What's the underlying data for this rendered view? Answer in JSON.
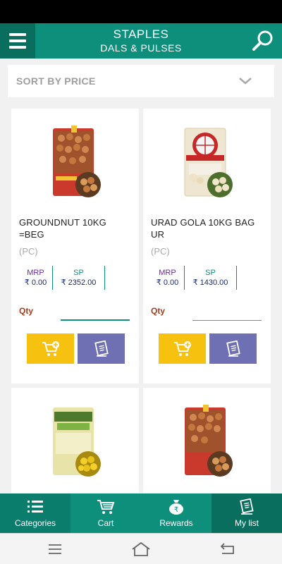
{
  "header": {
    "title": "STAPLES",
    "subtitle": "DALS & PULSES",
    "menu_icon": "hamburger-icon",
    "search_icon": "search-icon"
  },
  "sort": {
    "label": "SORT BY PRICE",
    "icon": "chevron-down-icon"
  },
  "products": [
    {
      "name": "GROUNDNUT 10KG =BEG",
      "unit": "(PC)",
      "mrp_label": "MRP",
      "mrp": "₹ 0.00",
      "sp_label": "SP",
      "sp": "₹ 2352.00",
      "qty_label": "Qty",
      "qty_value": ""
    },
    {
      "name": "URAD GOLA 10KG BAG UR",
      "unit": "(PC)",
      "mrp_label": "MRP",
      "mrp": "₹ 0.00",
      "sp_label": "SP",
      "sp": "₹ 1430.00",
      "qty_label": "Qty",
      "qty_value": ""
    },
    {
      "name": "",
      "unit": "",
      "mrp_label": "",
      "mrp": "",
      "sp_label": "",
      "sp": "",
      "qty_label": "",
      "qty_value": ""
    },
    {
      "name": "",
      "unit": "",
      "mrp_label": "",
      "mrp": "",
      "sp_label": "",
      "sp": "",
      "qty_label": "",
      "qty_value": ""
    }
  ],
  "bottom_nav": [
    {
      "label": "Categories",
      "icon": "list-icon"
    },
    {
      "label": "Cart",
      "icon": "cart-icon"
    },
    {
      "label": "Rewards",
      "icon": "rupee-bag-icon"
    },
    {
      "label": "My list",
      "icon": "clipboard-icon"
    }
  ],
  "colors": {
    "primary": "#0d8f7c",
    "primary_dark": "#0a6e5f",
    "add_to_cart": "#f6c20f",
    "add_to_list": "#6f6fb3",
    "mrp_label": "#6a2a8e",
    "price_text": "#1a2b6b"
  }
}
